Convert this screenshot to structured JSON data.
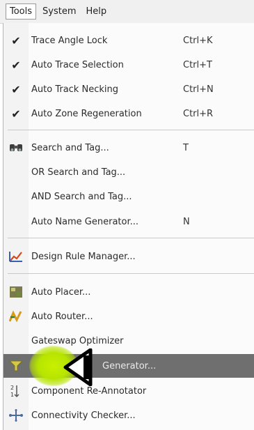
{
  "menubar": {
    "items": [
      {
        "label": "Tools"
      },
      {
        "label": "System"
      },
      {
        "label": "Help"
      }
    ]
  },
  "menu": {
    "toggles": [
      {
        "label": "Trace Angle Lock",
        "shortcut": "Ctrl+K",
        "icon": "check-icon"
      },
      {
        "label": "Auto Trace Selection",
        "shortcut": "Ctrl+T",
        "icon": "check-icon"
      },
      {
        "label": "Auto Track Necking",
        "shortcut": "Ctrl+N",
        "icon": "check-icon"
      },
      {
        "label": "Auto Zone Regeneration",
        "shortcut": "Ctrl+R",
        "icon": "check-icon"
      }
    ],
    "search": [
      {
        "label": "Search and Tag...",
        "shortcut": "T",
        "icon": "binoculars-icon"
      },
      {
        "label": "OR Search and Tag...",
        "shortcut": ""
      },
      {
        "label": "AND Search and Tag...",
        "shortcut": ""
      },
      {
        "label": "Auto Name Generator...",
        "shortcut": "N"
      }
    ],
    "design": [
      {
        "label": "Design Rule Manager...",
        "icon": "ruler-chart-icon"
      }
    ],
    "automation": [
      {
        "label": "Auto Placer...",
        "icon": "placer-icon"
      },
      {
        "label": "Auto Router...",
        "icon": "router-icon"
      },
      {
        "label": "Gateswap Optimizer",
        "icon": ""
      },
      {
        "label": "Generator...",
        "icon": "funnel-icon"
      },
      {
        "label": "Component Re-Annotator",
        "icon": "reannotate-icon"
      },
      {
        "label": "Connectivity Checker...",
        "icon": "connectivity-icon"
      }
    ]
  },
  "colors": {
    "highlight": "#6f6f6f",
    "cursor_glow": "#c8f000"
  }
}
